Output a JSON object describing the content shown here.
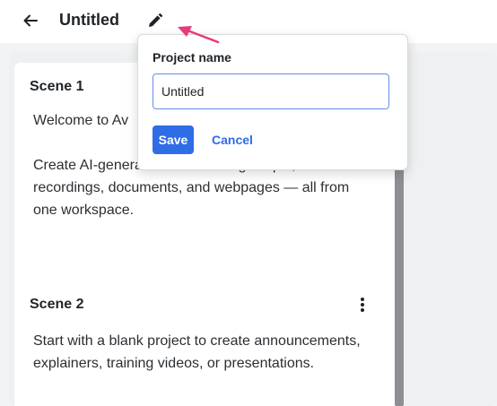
{
  "header": {
    "back_icon": "arrow-left-icon",
    "title": "Untitled",
    "edit_icon": "pencil-icon"
  },
  "scenes": [
    {
      "heading": "Scene 1",
      "paragraphs": [
        "Welcome to Av",
        "Create AI-generated videos using scripts, recordings, documents, and webpages — all from one workspace."
      ]
    },
    {
      "heading": "Scene 2",
      "menu_icon": "more-vertical-icon",
      "paragraphs": [
        "Start with a blank project to create announcements, explainers, training videos, or presentations."
      ]
    }
  ],
  "rename_popup": {
    "label": "Project name",
    "input_value": "Untitled",
    "save_label": "Save",
    "cancel_label": "Cancel"
  },
  "colors": {
    "accent": "#2f6de6",
    "annotation_arrow": "#e8397a"
  }
}
